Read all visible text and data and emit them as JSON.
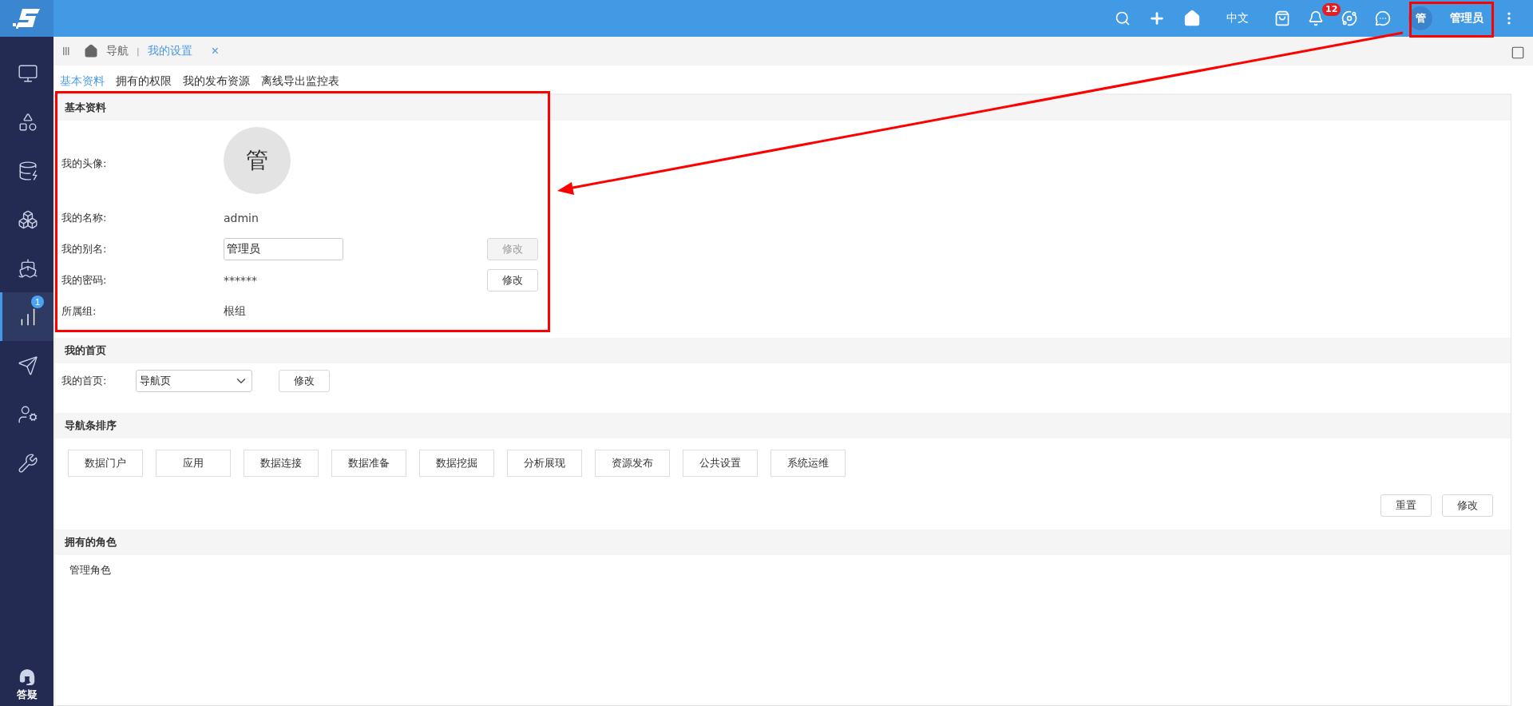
{
  "topbar": {
    "language": "中文",
    "notification_count": "12",
    "avatar_initial": "管",
    "user_name": "管理员"
  },
  "sidebar": {
    "items": [
      {
        "selected": false
      },
      {
        "selected": false
      },
      {
        "selected": false
      },
      {
        "selected": false
      },
      {
        "selected": false
      },
      {
        "selected": true,
        "badge": "1"
      },
      {
        "selected": false
      },
      {
        "selected": false
      },
      {
        "selected": false
      }
    ],
    "help_label": "答疑"
  },
  "breadcrumb": {
    "home": "导航",
    "separator": "|",
    "current": "我的设置",
    "close": "×"
  },
  "tabs": [
    {
      "label": "基本资料",
      "selected": true
    },
    {
      "label": "拥有的权限",
      "selected": false
    },
    {
      "label": "我的发布资源",
      "selected": false
    },
    {
      "label": "离线导出监控表",
      "selected": false
    }
  ],
  "basic_info": {
    "title": "基本资料",
    "avatar_label": "我的头像:",
    "avatar_initial": "管",
    "name_label": "我的名称:",
    "name_value": "admin",
    "alias_label": "我的别名:",
    "alias_value": "管理员",
    "alias_button": {
      "label": "修改",
      "disabled": true
    },
    "password_label": "我的密码:",
    "password_value": "******",
    "password_button": {
      "label": "修改",
      "disabled": false
    },
    "group_label": "所属组:",
    "group_value": "根组"
  },
  "homepage": {
    "title": "我的首页",
    "label": "我的首页:",
    "value": "导航页",
    "button": "修改"
  },
  "nav_order": {
    "title": "导航条排序",
    "items": [
      "数据门户",
      "应用",
      "数据连接",
      "数据准备",
      "数据挖掘",
      "分析展现",
      "资源发布",
      "公共设置",
      "系统运维"
    ],
    "reset_button": "重置",
    "modify_button": "修改"
  },
  "roles": {
    "title": "拥有的角色",
    "items": [
      "管理角色"
    ]
  }
}
